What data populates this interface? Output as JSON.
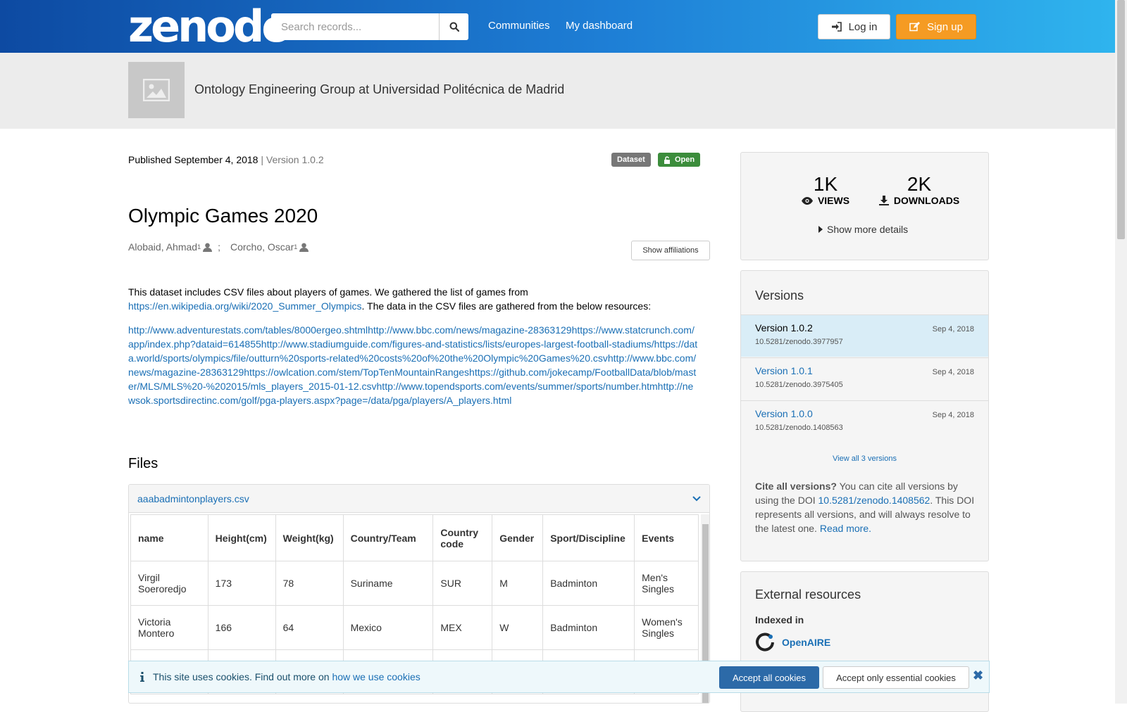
{
  "header": {
    "logo": "zenodo",
    "search_placeholder": "Search records...",
    "nav": [
      "Communities",
      "My dashboard"
    ],
    "login_label": "Log in",
    "signup_label": "Sign up"
  },
  "community": {
    "title": "Ontology Engineering Group at Universidad Politécnica de Madrid"
  },
  "record": {
    "published": "Published September 4, 2018",
    "version_sep": " | ",
    "version": "Version 1.0.2",
    "badge_type": "Dataset",
    "badge_access": "Open",
    "title": "Olympic Games 2020",
    "authors": [
      {
        "name": "Alobaid, Ahmad",
        "sup": "1"
      },
      {
        "name": "Corcho, Oscar",
        "sup": "1"
      }
    ],
    "author_sep": ";",
    "affiliations_button": "Show affiliations",
    "description_pre": "This dataset includes CSV files about players of games. We gathered the list of games from ",
    "description_link": "https://en.wikipedia.org/wiki/2020_Summer_Olympics",
    "description_post": ". The data in the CSV files are gathered from the below resources:",
    "resources": " http://www.adventurestats.com/tables/8000ergeo.shtmlhttp://www.bbc.com/news/magazine-28363129https://www.statcrunch.com/app/index.php?dataid=614855http://www.stadiumguide.com/figures-and-statistics/lists/europes-largest-football-stadiums/https://data.world/sports/olympics/file/outturn%20sports-related%20costs%20of%20the%20Olympic%20Games%20.csvhttp://www.bbc.com/news/magazine-28363129https://owlcation.com/stem/TopTenMountainRangeshttps://github.com/jokecamp/FootballData/blob/master/MLS/MLS%20-%202015/mls_players_2015-01-12.csvhttp://www.topendsports.com/events/summer/sports/number.htmhttp://newsok.sportsdirectinc.com/golf/pga-players.aspx?page=/data/pga/players/A_players.html"
  },
  "files": {
    "title": "Files",
    "filename": "aaabadmintonplayers.csv",
    "columns": [
      "name",
      "Height(cm)",
      "Weight(kg)",
      "Country/Team",
      "Country code",
      "Gender",
      "Sport/Discipline",
      "Events"
    ],
    "rows": [
      [
        "Virgil Soeroredjo",
        "173",
        "78",
        "Suriname",
        "SUR",
        "M",
        "Badminton",
        "Men's Singles"
      ],
      [
        "Victoria Montero",
        "166",
        "64",
        "Mexico",
        "MEX",
        "W",
        "Badminton",
        "Women's Singles"
      ],
      [
        "",
        "",
        "",
        "",
        "",
        "",
        "",
        ""
      ]
    ]
  },
  "stats": {
    "views_num": "1K",
    "views_label": "VIEWS",
    "downloads_num": "2K",
    "downloads_label": "DOWNLOADS",
    "more_details": "Show more details"
  },
  "versions": {
    "title": "Versions",
    "items": [
      {
        "name": "Version 1.0.2",
        "date": "Sep 4, 2018",
        "doi": "10.5281/zenodo.3977957",
        "active": true
      },
      {
        "name": "Version 1.0.1",
        "date": "Sep 4, 2018",
        "doi": "10.5281/zenodo.3975405",
        "active": false
      },
      {
        "name": "Version 1.0.0",
        "date": "Sep 4, 2018",
        "doi": "10.5281/zenodo.1408563",
        "active": false
      }
    ],
    "view_all": "View all 3 versions",
    "cite_bold": "Cite all versions?",
    "cite_pre": " You can cite all versions by using the DOI ",
    "cite_doi": "10.5281/zenodo.1408562",
    "cite_post": ". This DOI represents all versions, and will always resolve to the latest one. ",
    "cite_readmore": "Read more."
  },
  "external": {
    "title": "External resources",
    "indexed_in": "Indexed in",
    "openaire": "OpenAIRE"
  },
  "cookie": {
    "text": "This site uses cookies. Find out more on ",
    "link": "how we use cookies",
    "accept_all": "Accept all cookies",
    "accept_essential": "Accept only essential cookies",
    "close": "✖"
  },
  "colors": {
    "header_start": "#0d4aa2",
    "header_end": "#2fb4ee",
    "signup": "#f59b23",
    "open_badge": "#3c8d3c",
    "link": "#1a6fb5"
  }
}
